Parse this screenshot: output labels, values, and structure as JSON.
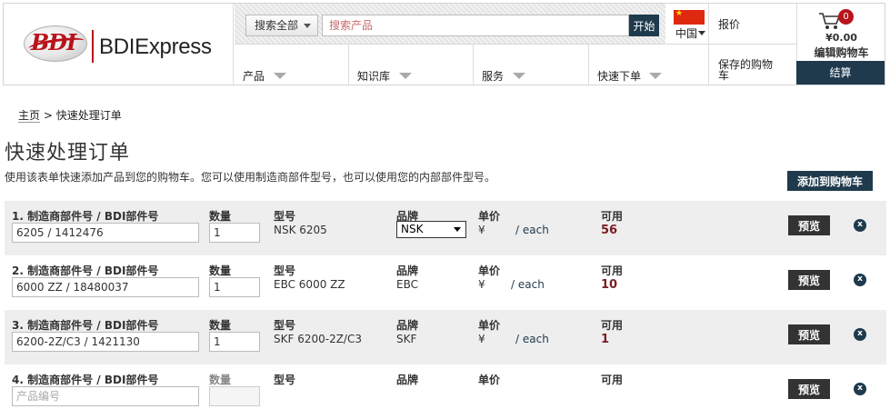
{
  "logo": {
    "mark": "BDI",
    "name": "BDIExpress"
  },
  "search": {
    "category": "搜索全部",
    "placeholder": "搜索产品",
    "go_label": "开始"
  },
  "lang": {
    "label": "中国"
  },
  "quote": {
    "label": "报价"
  },
  "nav": {
    "items": [
      "产品",
      "知识库",
      "服务",
      "快速下单"
    ]
  },
  "saved": {
    "label": "保存的购物车"
  },
  "cart": {
    "count": "0",
    "amount": "¥0.00",
    "edit_label": "编辑购物车",
    "checkout_label": "结算"
  },
  "breadcrumb": {
    "home": "主页",
    "separator": " > ",
    "current": "快速处理订单"
  },
  "page": {
    "title": "快速处理订单",
    "description": "使用该表单快速添加产品到您的购物车。您可以使用制造商部件型号，也可以使用您的内部部件型号。",
    "add_to_cart_label": "添加到购物车"
  },
  "order": {
    "labels": {
      "part": "制造商部件号 / BDI部件号",
      "qty": "数量",
      "model": "型号",
      "brand": "品牌",
      "price": "单价",
      "avail": "可用",
      "preview": "预览",
      "remove": "x",
      "currency": "¥",
      "each": "/ each"
    },
    "rows": [
      {
        "num": "1.",
        "part": "6205 / 1412476",
        "qty": "1",
        "model": "NSK 6205",
        "brand": "NSK",
        "avail": "56"
      },
      {
        "num": "2.",
        "part": "6000 ZZ / 18480037",
        "qty": "1",
        "model": "EBC 6000 ZZ",
        "brand": "EBC",
        "avail": "10"
      },
      {
        "num": "3.",
        "part": "6200-2Z/C3 / 1421130",
        "qty": "1",
        "model": "SKF 6200-2Z/C3",
        "brand": "SKF",
        "avail": "1"
      },
      {
        "num": "4.",
        "part_placeholder": "产品编号"
      }
    ]
  },
  "colors": {
    "navy": "#1f3a4d",
    "brand_red": "#b8141b",
    "avail_red": "#7a1e24"
  }
}
